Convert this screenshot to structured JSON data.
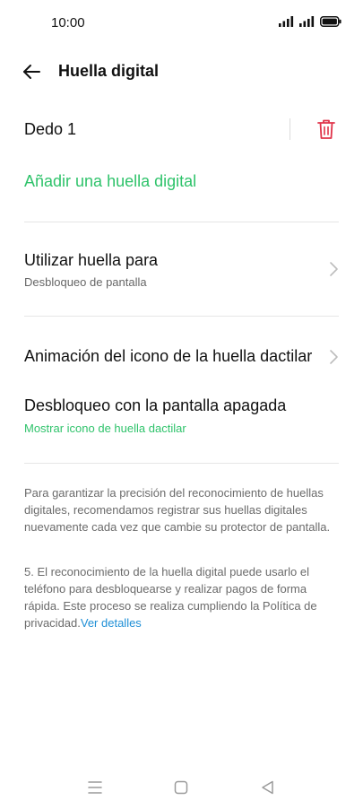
{
  "status_bar": {
    "time": "10:00",
    "icons": [
      "signal-icon",
      "signal-icon",
      "battery-icon"
    ]
  },
  "header": {
    "title": "Huella digital",
    "back_icon": "arrow-left-icon"
  },
  "finger": {
    "name": "Dedo 1",
    "delete_icon": "trash-icon",
    "delete_color": "#e0334a"
  },
  "add_fingerprint": {
    "label": "Añadir una huella digital",
    "color": "#2fc36b"
  },
  "settings": {
    "use_for": {
      "title": "Utilizar huella para",
      "subtitle": "Desbloqueo de pantalla"
    },
    "animation": {
      "title": "Animación del icono de la huella dactilar"
    },
    "screen_off": {
      "title": "Desbloqueo con la pantalla apagada",
      "subtitle": "Mostrar icono de huella dactilar"
    }
  },
  "notes": {
    "note1": "Para garantizar la precisión del reconocimiento de huellas digitales, recomendamos registrar sus huellas digitales nuevamente cada vez que cambie su protector de pantalla.",
    "note2": "5. El reconocimiento de la huella digital puede usarlo el teléfono para desbloquearse y realizar pagos de forma rápida. Este proceso se realiza cumpliendo la Política de privacidad.",
    "details_link": "Ver detalles",
    "link_color": "#1f8fd6"
  },
  "nav_bar": {
    "icons": [
      "menu-icon",
      "home-icon",
      "back-triangle-icon"
    ]
  }
}
